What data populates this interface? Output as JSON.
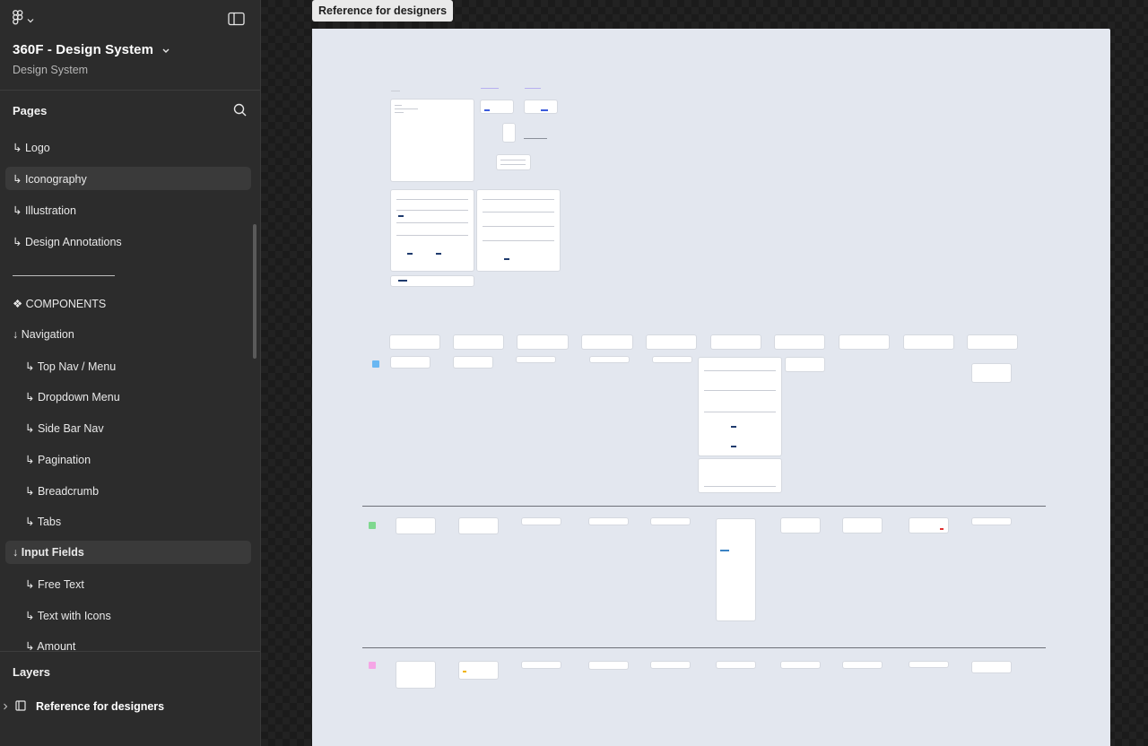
{
  "file": {
    "title": "360F - Design System",
    "subtitle": "Design System"
  },
  "pages": {
    "title": "Pages",
    "items": [
      {
        "label": "↳ Logo"
      },
      {
        "label": "↳ Iconography",
        "selected": true
      },
      {
        "label": "↳ Illustration"
      },
      {
        "label": "↳ Design Annotations"
      },
      {
        "label": "❖ COMPONENTS"
      },
      {
        "label": "↓ Navigation"
      },
      {
        "label": "↳ Top Nav / Menu"
      },
      {
        "label": "↳ Dropdown Menu"
      },
      {
        "label": "↳ Side Bar Nav"
      },
      {
        "label": "↳ Pagination"
      },
      {
        "label": "↳ Breadcrumb"
      },
      {
        "label": "↳ Tabs"
      },
      {
        "label": "↓ Input Fields",
        "selected": true
      },
      {
        "label": "↳ Free Text"
      },
      {
        "label": "↳ Text with Icons"
      },
      {
        "label": "↳ Amount"
      }
    ]
  },
  "layers": {
    "title": "Layers",
    "items": [
      {
        "label": "Reference for designers"
      }
    ]
  },
  "canvas": {
    "frame_label": "Reference for designers",
    "background": "#e3e7ef",
    "sticker_colors": [
      "#69b7f2",
      "#7fd88f",
      "#f5a6e6"
    ]
  },
  "icons": {
    "logo": "figma-logo-icon",
    "toggle": "sidebar-toggle-icon",
    "search": "search-icon",
    "frame": "frame-icon"
  }
}
